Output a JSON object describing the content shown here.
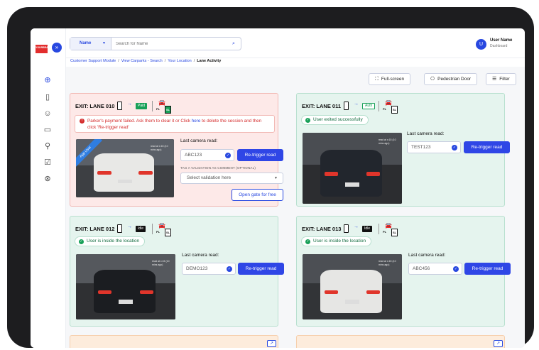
{
  "app": {
    "logo_text": "YOURBRAND",
    "collapse_icon": "chevron-right-icon"
  },
  "sidebar": {
    "icons": [
      "parking-icon",
      "receipt-icon",
      "users-icon",
      "ticket-icon",
      "pin-icon",
      "checklist-icon",
      "settings-icon"
    ]
  },
  "search": {
    "selector_value": "Name",
    "placeholder": "Search for Name"
  },
  "user": {
    "initial": "U",
    "name": "User Name",
    "subtitle": "Dashboard"
  },
  "breadcrumb": {
    "items": [
      "Customer Support Module",
      "View Carparks - Search",
      "Your Location"
    ],
    "current": "Lane Activity",
    "separator": "/"
  },
  "toolbar": {
    "fullscreen_label": "Full-screen",
    "pedestrian_label": "Pedestrian Door",
    "filter_label": "Filter"
  },
  "lanes": [
    {
      "title": "EXIT: LANE 010",
      "status": "Paid",
      "alert_text_1": "Parker's payment failed. Ask them to clear it or Click ",
      "alert_link": "here",
      "alert_text_2": " to delete the session and then click 'Re-trigger read'",
      "ribbon": "App User",
      "timestamp": "read at x:15 (10 mins ago)",
      "camera_label": "Last camera read:",
      "plate": "ABC123",
      "retrigger_label": "Re-trigger read",
      "validation_label": "TAG A VALIDATION AS COMMENT (OPTIONAL)",
      "validation_placeholder": "Select validation here",
      "open_gate_label": "Open gate for free"
    },
    {
      "title": "EXIT: LANE 011",
      "status": "Auth",
      "message": "User exited successfully",
      "timestamp": "read at x:15 (10 mins ago)",
      "camera_label": "Last camera read:",
      "plate": "TEST123",
      "retrigger_label": "Re-trigger read"
    },
    {
      "title": "EXIT: LANE 012",
      "status": "Idle",
      "message": "User is inside the location",
      "timestamp": "read at x:15 (10 mins ago)",
      "camera_label": "Last camera read:",
      "plate": "DEMO123",
      "retrigger_label": "Re-trigger read"
    },
    {
      "title": "EXIT: LANE 013",
      "status": "Idle",
      "message": "User is inside the location",
      "timestamp": "read at x:15 (10 mins ago)",
      "camera_label": "Last camera read:",
      "plate": "ABC456",
      "retrigger_label": "Re-trigger read"
    }
  ],
  "car_icon": {
    "pl": "PL",
    "sl": "SL"
  },
  "colors": {
    "primary": "#2848e0",
    "error_card": "#fde9e8",
    "success_card": "#e5f4ee",
    "paid_chip": "#18a058"
  }
}
